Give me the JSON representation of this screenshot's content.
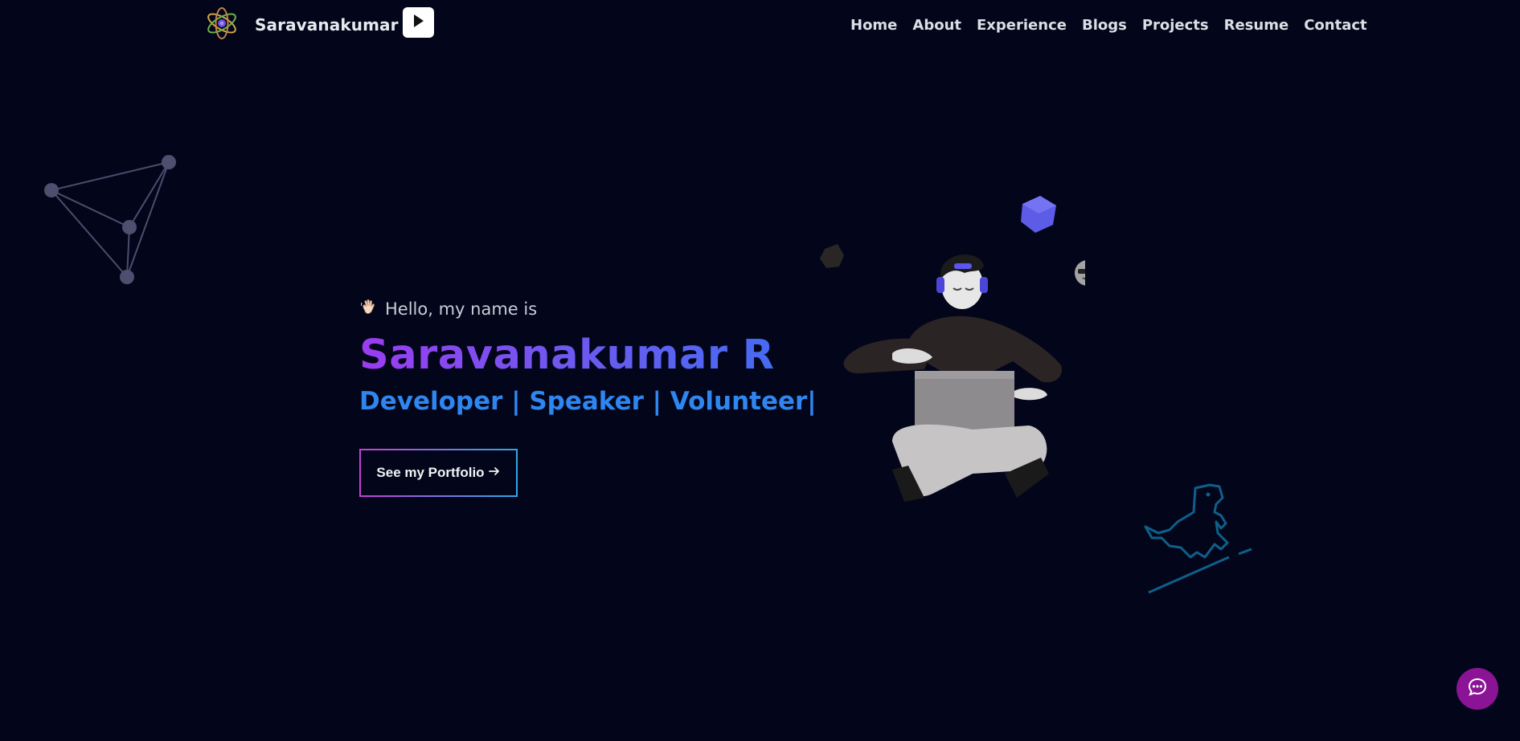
{
  "header": {
    "brand_name": "Saravanakumar",
    "brand_logo_icon": "atom-icon",
    "play_icon": "play-icon"
  },
  "nav": {
    "items": [
      {
        "label": "Home"
      },
      {
        "label": "About"
      },
      {
        "label": "Experience"
      },
      {
        "label": "Blogs"
      },
      {
        "label": "Projects"
      },
      {
        "label": "Resume"
      },
      {
        "label": "Contact"
      }
    ]
  },
  "hero": {
    "greeting_icon": "waving-hand-icon",
    "greeting": "Hello, my name is",
    "name": "Saravanakumar R",
    "roles": "Developer | Speaker | Volunteer|",
    "cta_label": "See my Portfolio",
    "cta_icon": "arrow-right-icon"
  },
  "decor": {
    "network_icon": "network-graph-icon",
    "illustration": "developer-with-laptop-illustration",
    "dino_icon": "dinosaur-icon"
  },
  "chat": {
    "icon": "chat-bubble-icon"
  },
  "colors": {
    "background": "#03061a",
    "name_gradient_start": "#9b3cf0",
    "name_gradient_end": "#3f6ef4",
    "roles": "#2f86f0",
    "chat_button": "#8b1496"
  }
}
